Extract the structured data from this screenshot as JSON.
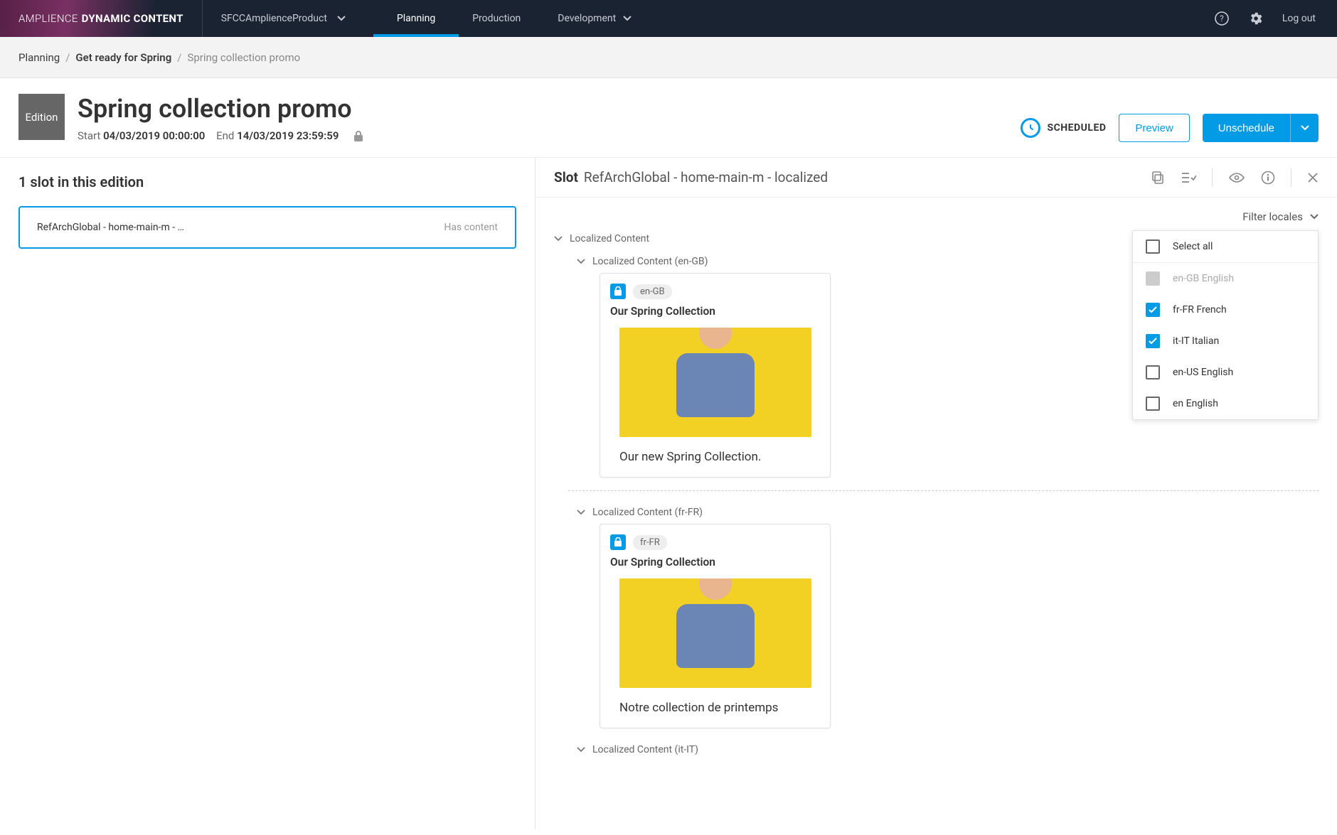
{
  "brand": {
    "light": "AMPLIENCE",
    "bold": "DYNAMIC CONTENT"
  },
  "hub": "SFCCAmplienceProduct",
  "nav": {
    "planning": "Planning",
    "production": "Production",
    "development": "Development"
  },
  "top": {
    "logout": "Log out"
  },
  "breadcrumb": {
    "level1": "Planning",
    "level2": "Get ready for Spring",
    "current": "Spring collection promo"
  },
  "page": {
    "iconLabel": "Edition",
    "title": "Spring collection promo",
    "startLabel": "Start",
    "startValue": "04/03/2019 00:00:00",
    "endLabel": "End",
    "endValue": "14/03/2019 23:59:59",
    "scheduled": "SCHEDULED",
    "preview": "Preview",
    "unschedule": "Unschedule"
  },
  "left": {
    "heading": "1 slot in this edition",
    "slot": {
      "name": "RefArchGlobal - home-main-m - …",
      "status": "Has content"
    }
  },
  "slotHeader": {
    "label": "Slot",
    "name": "RefArchGlobal - home-main-m - localized"
  },
  "filter": {
    "label": "Filter locales",
    "options": {
      "selectAll": "Select all",
      "enGB": "en-GB English",
      "frFR": "fr-FR French",
      "itIT": "it-IT Italian",
      "enUS": "en-US English",
      "en": "en English"
    }
  },
  "sections": {
    "root": "Localized Content",
    "enGB": "Localized Content (en-GB)",
    "frFR": "Localized Content (fr-FR)",
    "itIT": "Localized Content (it-IT)"
  },
  "cards": {
    "enGB": {
      "tag": "en-GB",
      "title": "Our Spring Collection",
      "caption": "Our new Spring Collection."
    },
    "frFR": {
      "tag": "fr-FR",
      "title": "Our Spring Collection",
      "caption": "Notre collection de printemps"
    }
  }
}
